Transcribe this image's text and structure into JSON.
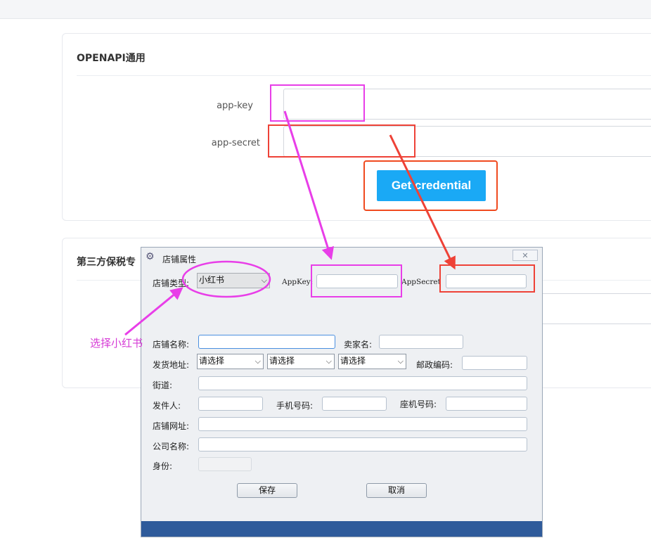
{
  "card1": {
    "title": "OPENAPI通用",
    "app_key_label": "app-key",
    "app_secret_label": "app-secret",
    "get_credential_label": "Get credential"
  },
  "card2": {
    "title": "第三方保税专"
  },
  "dialog": {
    "title": "店铺属性",
    "close_glyph": "✕",
    "shop_type_label": "店铺类型:",
    "shop_type_value": "小红书",
    "appkey_label": "AppKey:",
    "appsecret_label": "AppSecret",
    "shop_name_label": "店铺名称:",
    "seller_name_label": "卖家名:",
    "ship_address_label": "发货地址:",
    "province_value": "请选择",
    "city_value": "请选择",
    "district_value": "请选择",
    "postcode_label": "邮政编码:",
    "street_label": "街道:",
    "sender_label": "发件人:",
    "mobile_label": "手机号码:",
    "landline_label": "座机号码:",
    "shop_url_label": "店铺网址:",
    "company_label": "公司名称:",
    "identity_label": "身份:",
    "save_label": "保存",
    "cancel_label": "取消"
  },
  "annotation": {
    "select_text": "选择小红书",
    "magenta": "#e83ee8",
    "red": "#ee4237"
  },
  "colors": {
    "accent": "#1aa9f5",
    "dialog_footer": "#2f5b9b"
  }
}
